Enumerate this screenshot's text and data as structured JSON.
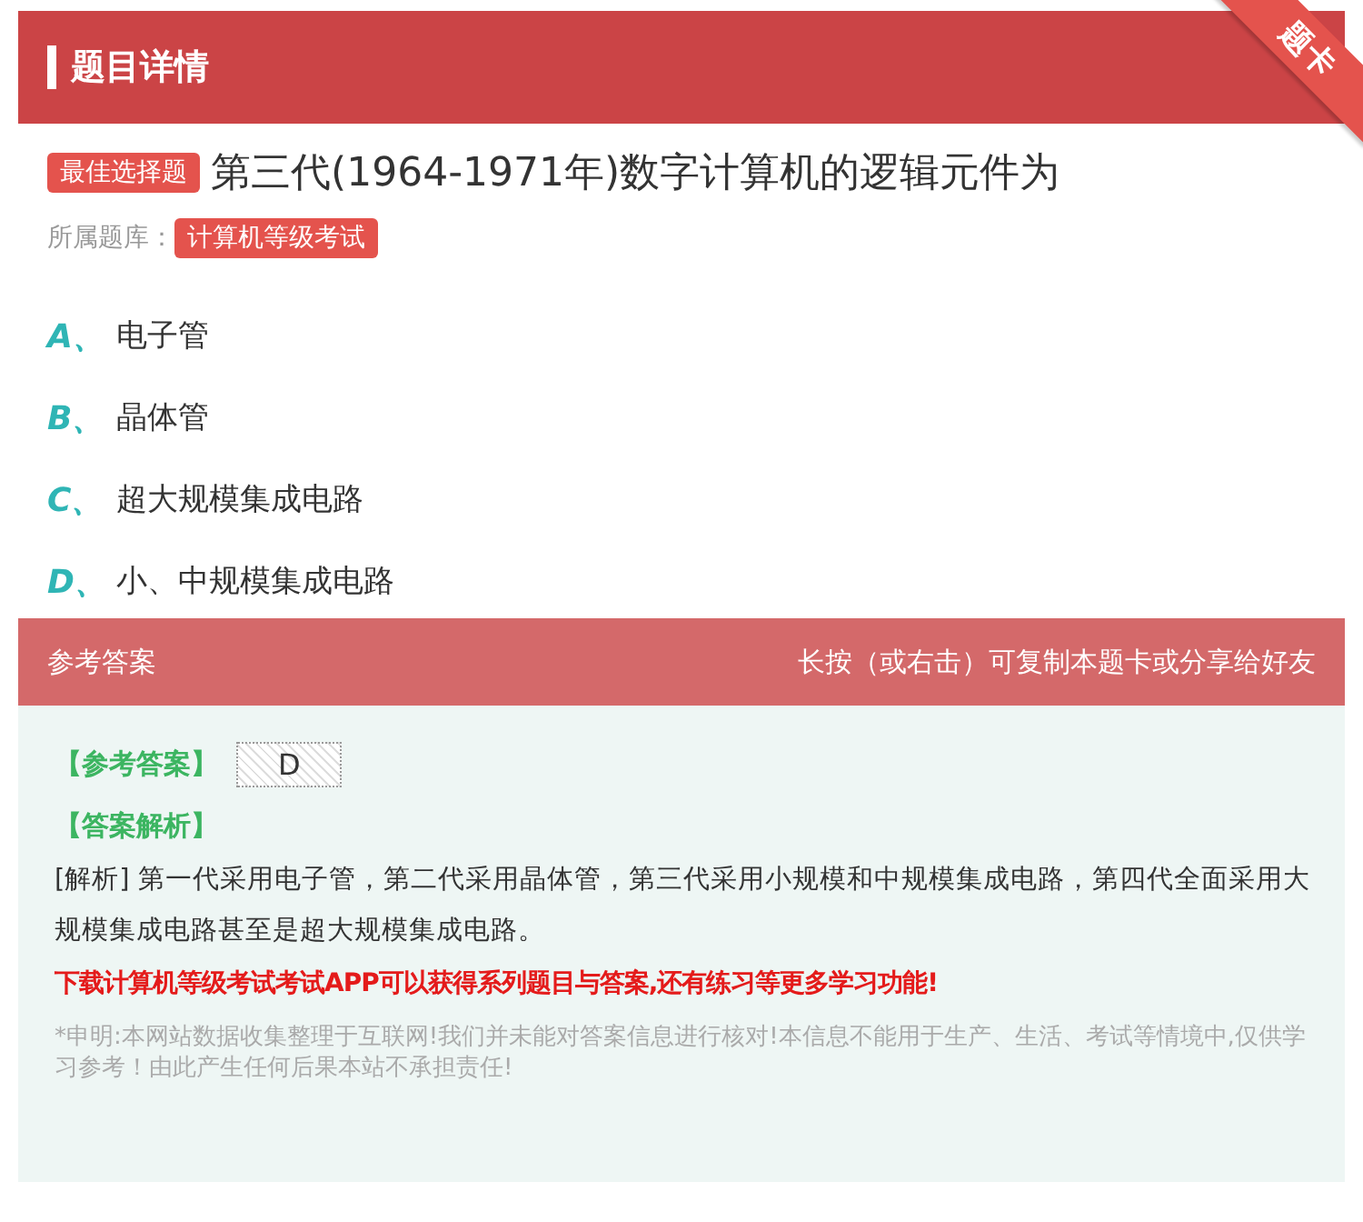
{
  "header": {
    "title": "题目详情",
    "ribbon": "题卡"
  },
  "question": {
    "type_badge": "最佳选择题",
    "text": "第三代(1964-1971年)数字计算机的逻辑元件为",
    "bank_label": "所属题库：",
    "bank": "计算机等级考试"
  },
  "options": [
    {
      "letter": "A、",
      "text": "电子管"
    },
    {
      "letter": "B、",
      "text": "晶体管"
    },
    {
      "letter": "C、",
      "text": "超大规模集成电路"
    },
    {
      "letter": "D、",
      "text": "小、中规模集成电路"
    }
  ],
  "answer_bar": {
    "title": "参考答案",
    "hint": "长按（或右击）可复制本题卡或分享给好友"
  },
  "answer": {
    "label": "【参考答案】",
    "value": "D",
    "analysis_label": "【答案解析】",
    "analysis": "[解析] 第一代采用电子管，第二代采用晶体管，第三代采用小规模和中规模集成电路，第四代全面采用大规模集成电路甚至是超大规模集成电路。",
    "promo": "下载计算机等级考试考试APP可以获得系列题目与答案,还有练习等更多学习功能!",
    "disclaimer": "*申明:本网站数据收集整理于互联网!我们并未能对答案信息进行核对!本信息不能用于生产、生活、考试等情境中,仅供学习参考！由此产生任何后果本站不承担责任!"
  }
}
